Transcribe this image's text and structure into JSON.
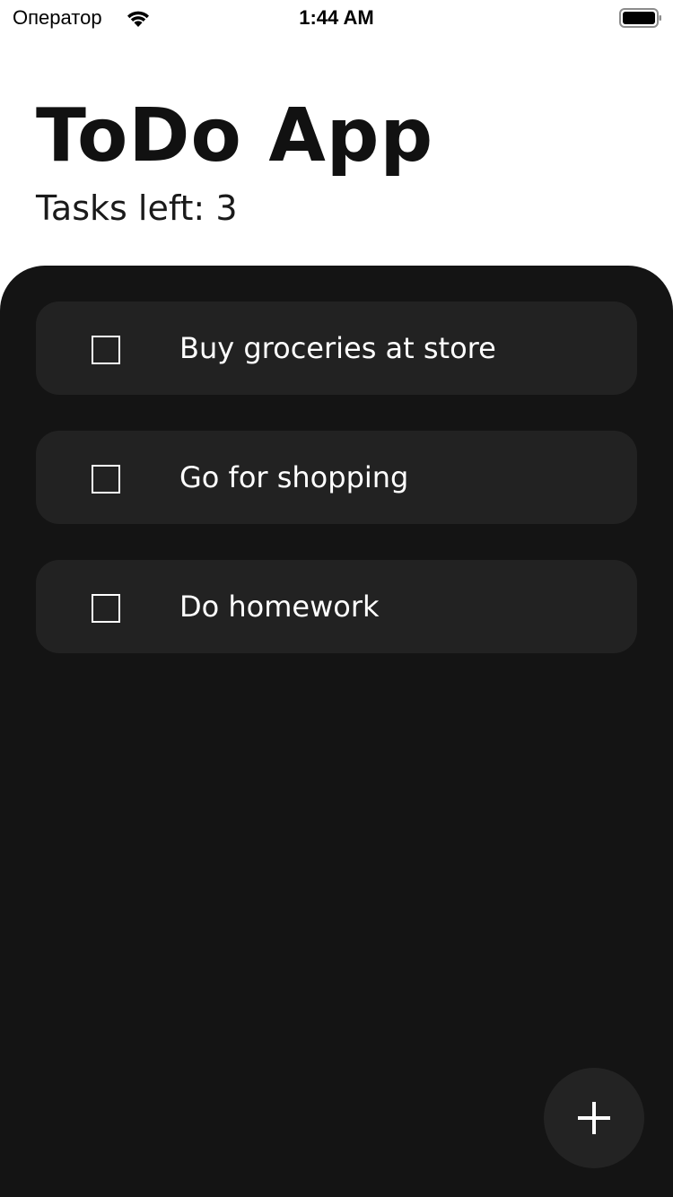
{
  "status_bar": {
    "carrier": "Оператор",
    "time": "1:44 AM",
    "wifi_icon": "wifi-icon",
    "battery_icon": "battery-full-icon"
  },
  "header": {
    "title": "ToDo App",
    "tasks_left_label": "Tasks left: 3"
  },
  "tasks": [
    {
      "label": "Buy groceries at store",
      "checked": false
    },
    {
      "label": "Go for shopping",
      "checked": false
    },
    {
      "label": "Do homework",
      "checked": false
    }
  ],
  "fab": {
    "icon": "plus-icon"
  },
  "colors": {
    "panel_background": "#141414",
    "task_background": "#222222",
    "title_text": "#111111",
    "task_text": "#ffffff"
  }
}
